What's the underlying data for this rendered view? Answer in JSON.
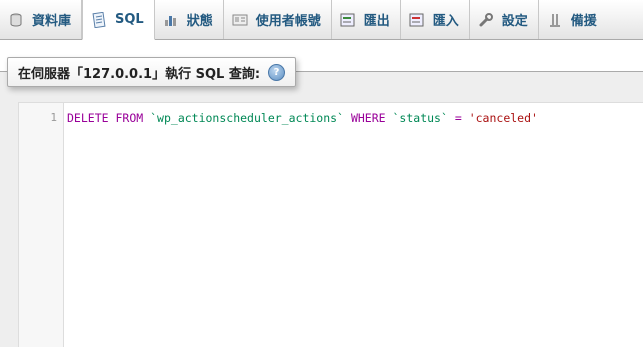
{
  "tabs": [
    {
      "label": "資料庫",
      "icon": "database-icon"
    },
    {
      "label": "SQL",
      "icon": "sql-icon",
      "active": true
    },
    {
      "label": "狀態",
      "icon": "status-chart-icon"
    },
    {
      "label": "使用者帳號",
      "icon": "user-accounts-icon"
    },
    {
      "label": "匯出",
      "icon": "export-icon"
    },
    {
      "label": "匯入",
      "icon": "import-icon"
    },
    {
      "label": "設定",
      "icon": "wrench-icon"
    },
    {
      "label": "備援",
      "icon": "replication-icon"
    }
  ],
  "query_box": {
    "legend": "在伺服器「127.0.0.1」執行 SQL 查詢:",
    "help_symbol": "?"
  },
  "editor": {
    "line_number": "1",
    "tokens": {
      "kw_delete": "DELETE",
      "kw_from": "FROM",
      "table": "`wp_actionscheduler_actions`",
      "kw_where": "WHERE",
      "column": "`status`",
      "op": "=",
      "value": "'canceled'"
    }
  }
}
